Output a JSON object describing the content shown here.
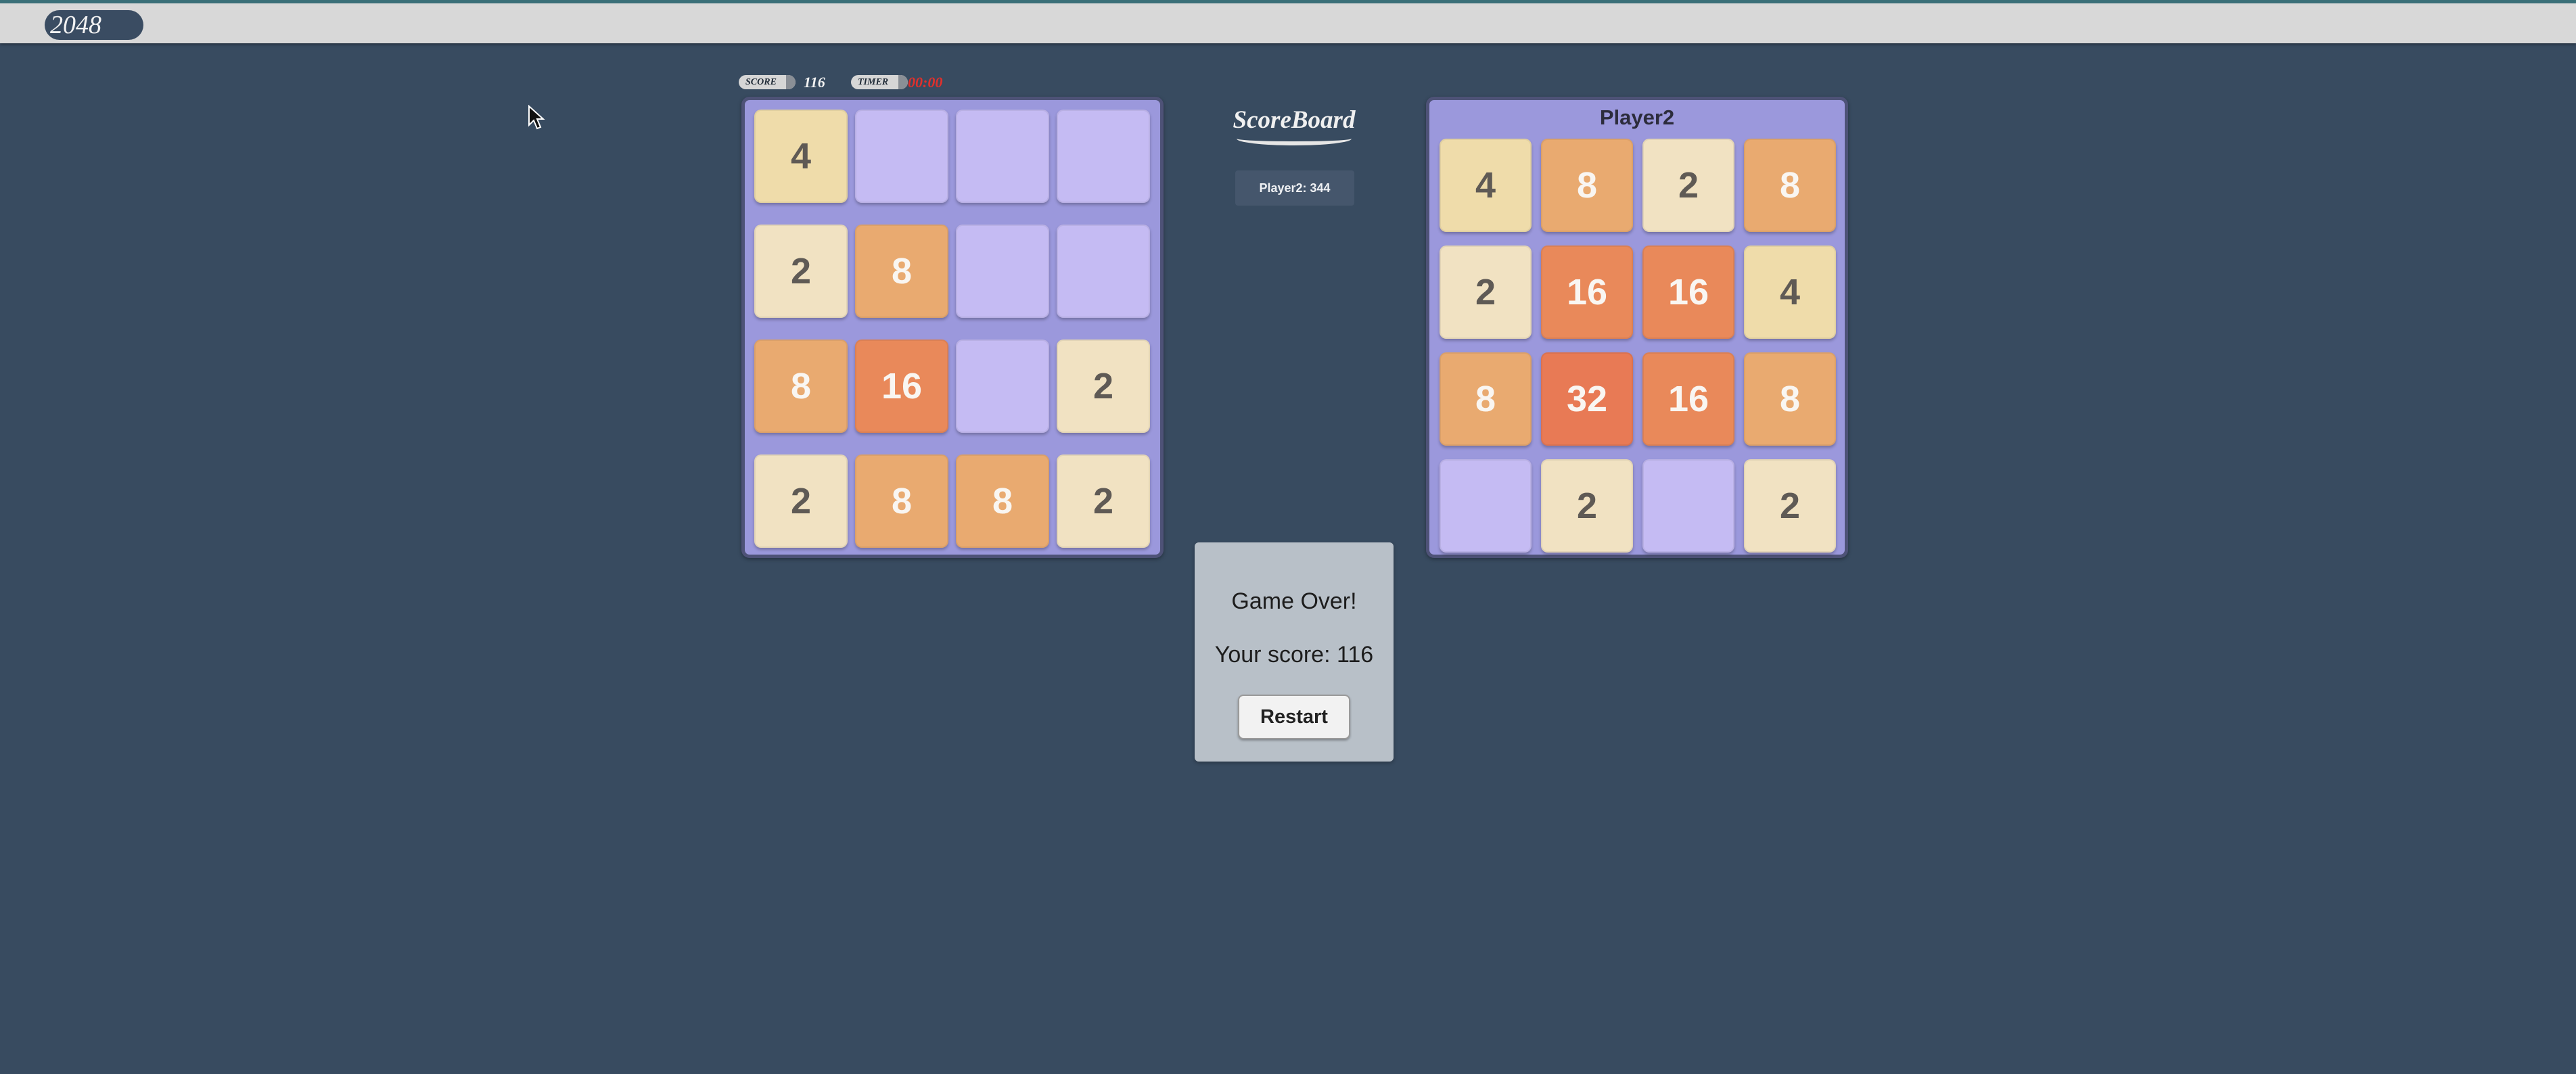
{
  "app": {
    "title": "2048"
  },
  "player1": {
    "score_label": "SCORE",
    "score": "116",
    "timer_label": "TIMER",
    "timer": "00:00",
    "timer_color": "#e0302c",
    "grid": [
      [
        4,
        0,
        0,
        0
      ],
      [
        2,
        8,
        0,
        0
      ],
      [
        8,
        16,
        0,
        2
      ],
      [
        2,
        8,
        8,
        2
      ]
    ]
  },
  "scoreboard": {
    "title": "ScoreBoard",
    "entries": [
      "Player2: 344"
    ]
  },
  "player2": {
    "name": "Player2",
    "grid": [
      [
        4,
        8,
        2,
        8
      ],
      [
        2,
        16,
        16,
        4
      ],
      [
        8,
        32,
        16,
        8
      ],
      [
        0,
        2,
        0,
        2
      ]
    ]
  },
  "game_over": {
    "title": "Game Over!",
    "score_text": "Your score: 116",
    "restart_label": "Restart"
  },
  "icons": {
    "cursor": "mouse-pointer-icon"
  },
  "colors": {
    "background": "#384b60",
    "board": "#9b98dc",
    "empty_tile": "#c5bbf3"
  }
}
